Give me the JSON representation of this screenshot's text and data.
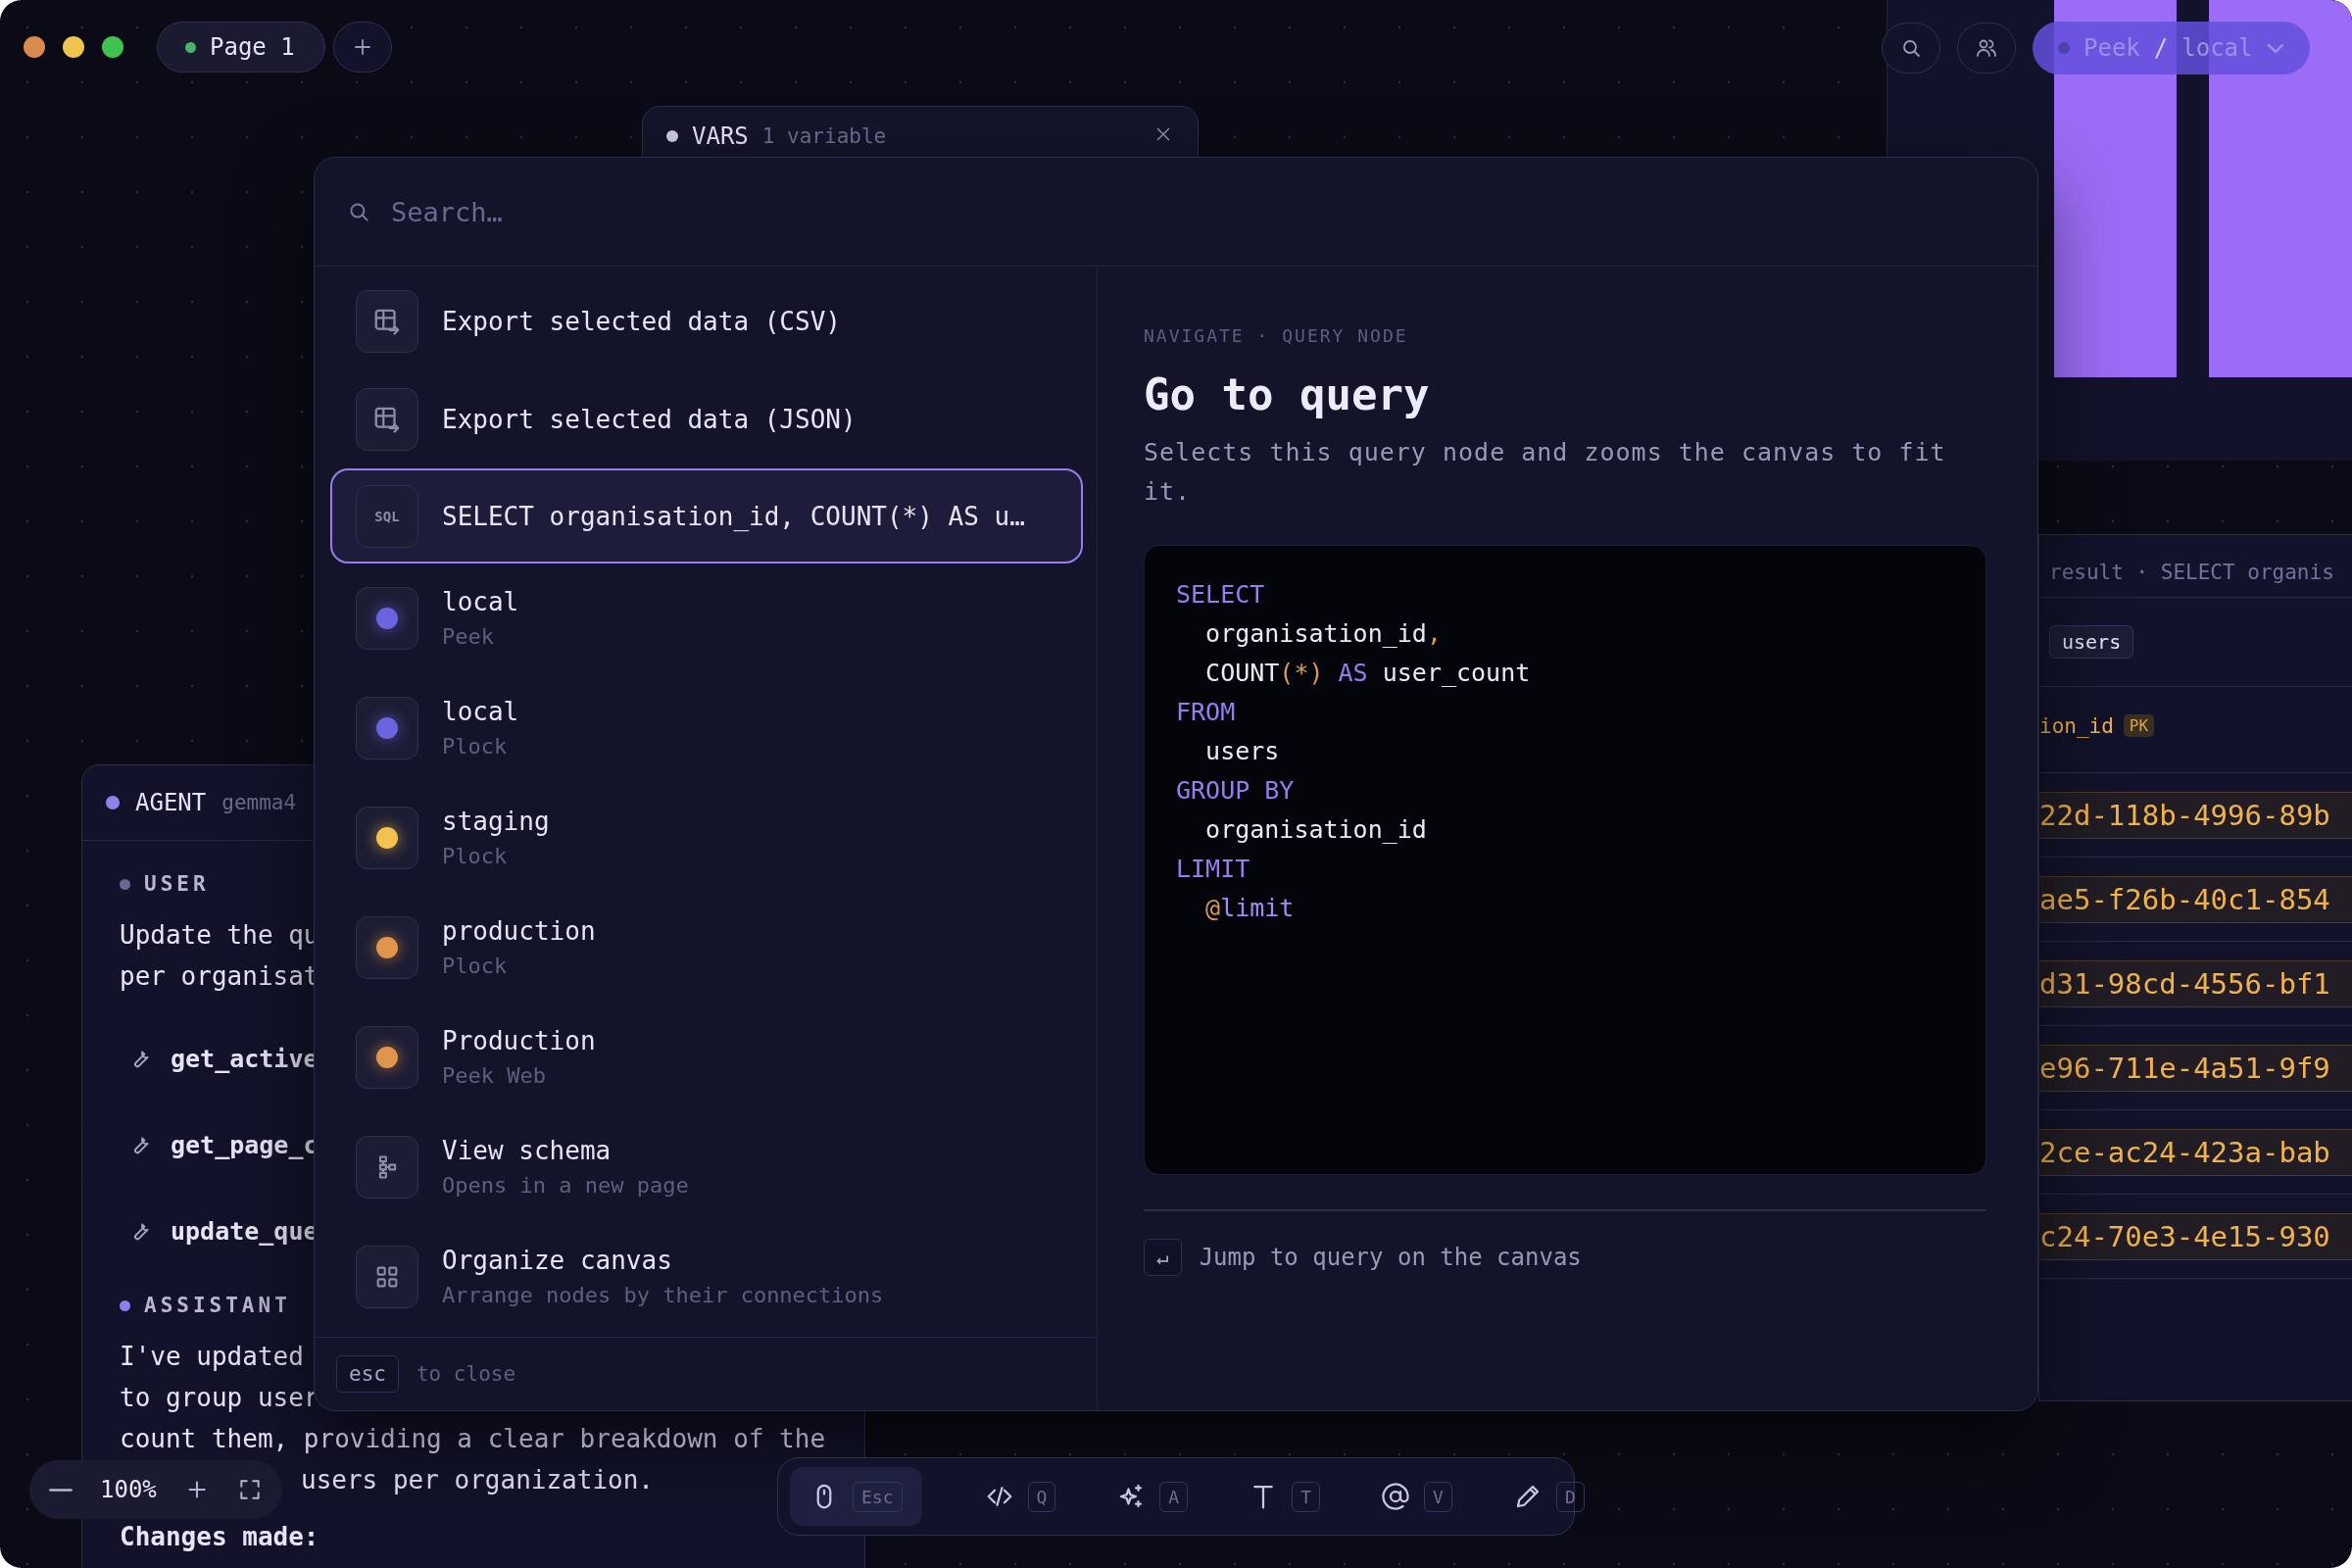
{
  "tabs": [
    {
      "label": "Page 1",
      "selected": true
    }
  ],
  "connection": {
    "app": "Peek",
    "separator": "/",
    "env": "local"
  },
  "vars_panel": {
    "title": "VARS",
    "subtitle": "1 variable"
  },
  "palette": {
    "search": {
      "placeholder": "Search…"
    },
    "items": [
      {
        "kind": "export",
        "title": "Export selected data (CSV)",
        "selected": false
      },
      {
        "kind": "export",
        "title": "Export selected data (JSON)",
        "selected": false
      },
      {
        "kind": "sql",
        "icon_text": "SQL",
        "title": "SELECT organisation_id, COUNT(*) AS u…",
        "selected": true
      },
      {
        "kind": "connection",
        "title": "local",
        "subtitle": "Peek",
        "color": "#6b63e0",
        "selected": false
      },
      {
        "kind": "connection",
        "title": "local",
        "subtitle": "Plock",
        "color": "#6b63e0",
        "selected": false
      },
      {
        "kind": "connection",
        "title": "staging",
        "subtitle": "Plock",
        "color": "#f2c14e",
        "selected": false
      },
      {
        "kind": "connection",
        "title": "production",
        "subtitle": "Plock",
        "color": "#e0954a",
        "selected": false
      },
      {
        "kind": "connection",
        "title": "Production",
        "subtitle": "Peek Web",
        "color": "#e0954a",
        "selected": false
      },
      {
        "kind": "schema",
        "title": "View schema",
        "subtitle": "Opens in a new page",
        "selected": false
      },
      {
        "kind": "organize",
        "title": "Organize canvas",
        "subtitle": "Arrange nodes by their connections",
        "selected": false
      }
    ],
    "footer": {
      "key": "esc",
      "hint": "to close"
    },
    "preview": {
      "breadcrumb": "NAVIGATE · QUERY NODE",
      "title": "Go to query",
      "description": "Selects this query node and zooms the canvas to fit it.",
      "code": [
        [
          {
            "text": "SELECT",
            "kind": "keyword"
          }
        ],
        [
          {
            "text": "  organisation_id",
            "kind": "plain"
          },
          {
            "text": ",",
            "kind": "punct"
          }
        ],
        [
          {
            "text": "  COUNT",
            "kind": "plain"
          },
          {
            "text": "(*)",
            "kind": "punct"
          },
          {
            "text": " AS",
            "kind": "keyword"
          },
          {
            "text": " user_count",
            "kind": "plain"
          }
        ],
        [
          {
            "text": "FROM",
            "kind": "keyword"
          }
        ],
        [
          {
            "text": "  users",
            "kind": "plain"
          }
        ],
        [
          {
            "text": "GROUP BY",
            "kind": "keyword"
          }
        ],
        [
          {
            "text": "  organisation_id",
            "kind": "plain"
          }
        ],
        [
          {
            "text": "LIMIT",
            "kind": "keyword"
          }
        ],
        [
          {
            "text": "  @",
            "kind": "punct"
          },
          {
            "text": "limit",
            "kind": "param"
          }
        ]
      ],
      "action": {
        "key": "↵",
        "label": "Jump to query on the canvas"
      }
    }
  },
  "agent": {
    "title": "AGENT",
    "model": "gemma4",
    "user": {
      "label": "USER",
      "lines": [
        "Update the qu",
        "per organisat"
      ]
    },
    "tool_calls": [
      "get_active",
      "get_page_c",
      "update_que"
    ],
    "assistant": {
      "label": "ASSISTANT",
      "lines": [
        "I've updated",
        "to group user",
        "count them, providing a clear breakdown of the",
        "users per organization."
      ],
      "heading": "Changes made:"
    }
  },
  "result_panel": {
    "title": "result · SELECT organis",
    "table_tag": "users",
    "column": "ion_id",
    "column_badge": "PK",
    "rows": [
      "22d-118b-4996-89b",
      "ae5-f26b-40c1-854",
      "d31-98cd-4556-bf1",
      "e96-711e-4a51-9f9",
      "2ce-ac24-423a-bab",
      "c24-70e3-4e15-930"
    ]
  },
  "zoom": {
    "level": "100%"
  },
  "toolbar": {
    "tools": [
      {
        "kind": "pointer",
        "shortcut": "Esc",
        "selected": true
      },
      {
        "kind": "code",
        "shortcut": "Q",
        "selected": false
      },
      {
        "kind": "ai",
        "shortcut": "A",
        "selected": false
      },
      {
        "kind": "text",
        "shortcut": "T",
        "selected": false
      },
      {
        "kind": "mention",
        "shortcut": "V",
        "selected": false
      },
      {
        "kind": "draw",
        "shortcut": "D",
        "selected": false
      }
    ]
  }
}
